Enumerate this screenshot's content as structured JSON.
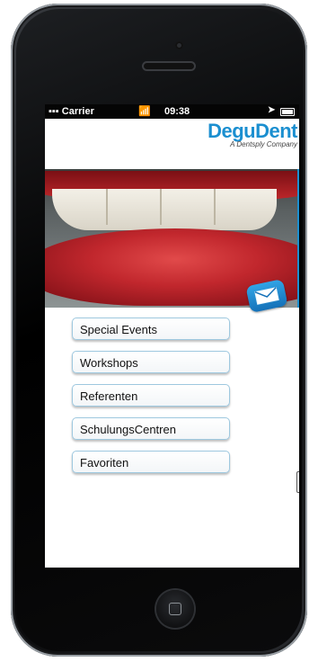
{
  "statusbar": {
    "carrier": "Carrier",
    "time": "09:38",
    "wifi_icon": "wifi-icon",
    "location_icon": "location-arrow-icon",
    "battery_icon": "battery-icon"
  },
  "brand": {
    "name": "DeguDent",
    "tagline": "A Dentsply Company",
    "accent": "#1b8fd0"
  },
  "menu": {
    "items": [
      {
        "label": "Special Events"
      },
      {
        "label": "Workshops"
      },
      {
        "label": "Referenten"
      },
      {
        "label": "SchulungsCentren"
      },
      {
        "label": "Favoriten"
      }
    ]
  }
}
